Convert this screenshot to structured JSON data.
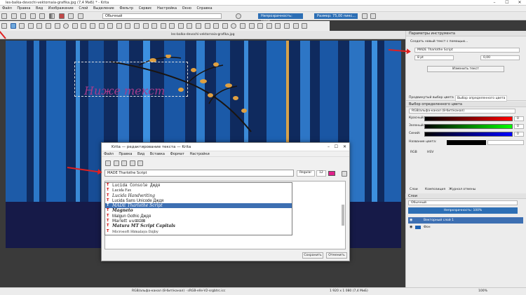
{
  "window": {
    "title": "les-balka-devochi-vektornaia-grafika.jpg (7,4 МиБ) * - Krita",
    "controls": [
      "–",
      "☐",
      "✕"
    ]
  },
  "menu": [
    "Файл",
    "Правка",
    "Вид",
    "Изображение",
    "Слой",
    "Выделение",
    "Фильтр",
    "Сервис",
    "Настройка",
    "Окно",
    "Справка"
  ],
  "toolbar": {
    "blend_mode": "Обычный",
    "opacity_label": "Непрозрачность: 100%",
    "size_label": "Размер: 75,00 пикс..."
  },
  "document_tab": "les-balka-devochi-vektornaia-grafika.jpg",
  "canvas": {
    "text_overlay": "Ниже текст"
  },
  "tool_options": {
    "header": "Параметры инструмента",
    "create_mode": "Создать новый текст с помощью...",
    "font": "MADE Tharlothe Script",
    "size": "8 pt",
    "spacing": "0,00",
    "edit_button": "Изменить текст"
  },
  "color_panel": {
    "tab1": "Продвинутый выбор цвета",
    "tab2": "Выбор определенного цвета",
    "header": "Выбор определенного цвета",
    "model": "RGB/альфа-канал (8-бит/канал)",
    "channels": [
      {
        "label": "Красный:",
        "value": "0"
      },
      {
        "label": "Зеленый:",
        "value": "0"
      },
      {
        "label": "Синий:",
        "value": "0"
      }
    ],
    "hex_label": "Название цвета:",
    "radio1": "RGB",
    "radio2": "HSV"
  },
  "layers_panel": {
    "tab1": "Слои",
    "tab2": "Композиция",
    "tab3": "Журнал отмены",
    "header": "Слои",
    "blend": "Обычный",
    "opacity": "Непрозрачность: 100%",
    "layers": [
      {
        "name": "Векторный слой 1",
        "selected": true
      },
      {
        "name": "Фон",
        "selected": false
      }
    ]
  },
  "dialog": {
    "title": "Krita — редактирование текста — Krita",
    "menu": [
      "Файл",
      "Правка",
      "Вид",
      "Вставка",
      "Формат",
      "Настройки"
    ],
    "font_combo": "MADE Tharlothe Script",
    "style_combo": "Regular",
    "size_combo": "12",
    "fonts": [
      {
        "name": "Lucida Console  Дждя",
        "family": "Liberation Mono, monospace",
        "selected": false
      },
      {
        "name": "Lucida Fax",
        "family": "Liberation Serif, serif",
        "selected": false
      },
      {
        "name": "Lucida Handwriting",
        "family": "DejaVu Serif, serif",
        "selected": false
      },
      {
        "name": "Lucida Sans Unicode  Дждя",
        "family": "Liberation Sans, sans-serif",
        "selected": false
      },
      {
        "name": "MADE Tharlothe Script",
        "family": "DejaVu Serif, serif",
        "selected": true
      },
      {
        "name": "Magneto",
        "family": "DejaVu Serif, serif",
        "selected": false
      },
      {
        "name": "Malgun Gothic  Дждя",
        "family": "Liberation Sans, sans-serif",
        "selected": false
      },
      {
        "name": "Marlett  ⊍⊌⊞⊟⊠",
        "family": "DejaVu Sans, sans-serif",
        "selected": false
      },
      {
        "name": "Matura MT Script Capitals",
        "family": "DejaVu Serif, serif",
        "selected": false
      },
      {
        "name": "Microsoft Himalaya  Dzjby",
        "family": "DejaVu Serif, serif",
        "selected": false
      }
    ],
    "save_button": "Сохранить",
    "cancel_button": "Отменить"
  },
  "status": {
    "left": "RGB/альфа-канал (8-бит/канал) · sRGB-elle-V2-srgbtrc.icc",
    "center": "1 920 x 1 080 (7,4 МиБ)",
    "zoom": "100%"
  },
  "colors": {
    "accent": "#2d6fb5",
    "swatch": "#e0208a",
    "arrow": "#e02020"
  }
}
